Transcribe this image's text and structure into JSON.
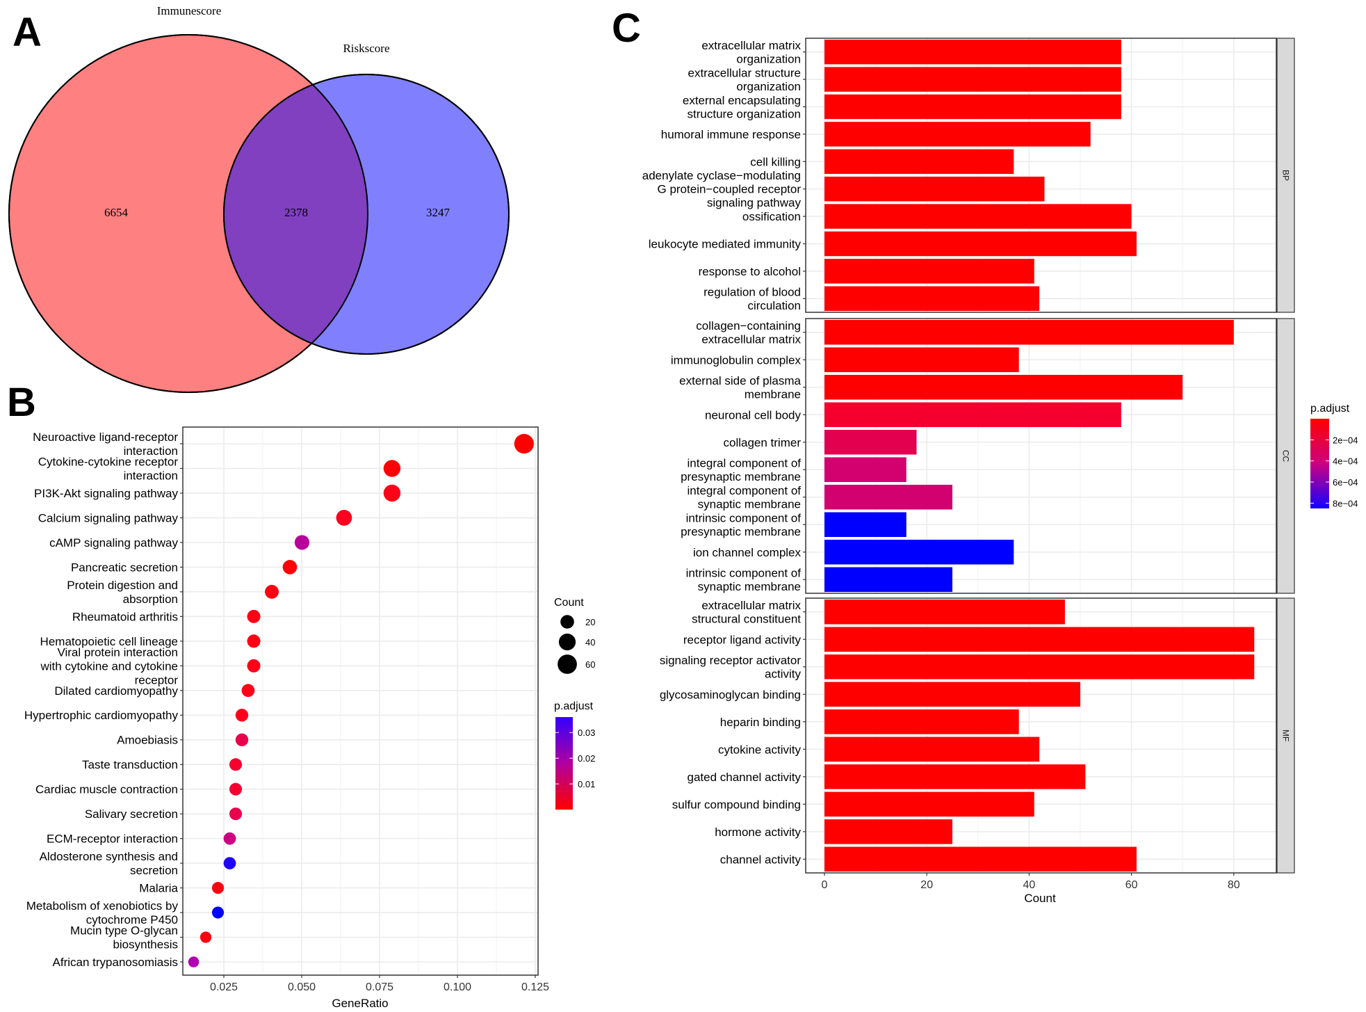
{
  "figure": {
    "panel_labels": [
      "A",
      "B",
      "C"
    ]
  },
  "chart_data": [
    {
      "id": "A",
      "type": "venn",
      "title": "",
      "sets": [
        {
          "name": "Immunescore",
          "only": 6654,
          "color": "#FF8080"
        },
        {
          "name": "Riskscore",
          "only": 3247,
          "color": "#8080FF"
        }
      ],
      "intersection": 2378,
      "intersection_color": "#8040C0"
    },
    {
      "id": "B",
      "type": "scatter",
      "subtype": "dotplot",
      "title": "",
      "xlabel": "GeneRatio",
      "ylabel": "",
      "xlim": [
        0.0125,
        0.1275
      ],
      "xticks": [
        0.025,
        0.05,
        0.075,
        0.1,
        0.125
      ],
      "xtick_labels": [
        "0.025",
        "0.050",
        "0.075",
        "0.100",
        "0.125"
      ],
      "grid": true,
      "legend": {
        "placement": "right",
        "size": {
          "title": "Count",
          "values": [
            20,
            40,
            60
          ],
          "labels": [
            "20",
            "40",
            "60"
          ]
        },
        "color": {
          "title": "p.adjust",
          "range": [
            0.0,
            0.036
          ],
          "ticks": [
            0.01,
            0.02,
            0.03
          ],
          "labels": [
            "0.01",
            "0.02",
            "0.03"
          ],
          "low_color": "#FF0000",
          "high_color": "#0000FF"
        }
      },
      "points": [
        {
          "term": "Neuroactive ligand-receptor interaction",
          "lines": [
            "Neuroactive ligand-receptor",
            "interaction"
          ],
          "gene_ratio": 0.1214,
          "count": 63,
          "p_adjust": 0.0002,
          "color": "#FF0000"
        },
        {
          "term": "Cytokine-cytokine receptor interaction",
          "lines": [
            "Cytokine-cytokine receptor",
            "interaction"
          ],
          "gene_ratio": 0.079,
          "count": 41,
          "p_adjust": 0.001,
          "color": "#FF0008"
        },
        {
          "term": "PI3K-Akt signaling pathway",
          "lines": [
            "PI3K-Akt signaling pathway"
          ],
          "gene_ratio": 0.079,
          "count": 41,
          "p_adjust": 0.002,
          "color": "#FF0018"
        },
        {
          "term": "Calcium signaling pathway",
          "lines": [
            "Calcium signaling pathway"
          ],
          "gene_ratio": 0.0636,
          "count": 33,
          "p_adjust": 0.003,
          "color": "#FC0020"
        },
        {
          "term": "cAMP signaling pathway",
          "lines": [
            "cAMP signaling pathway"
          ],
          "gene_ratio": 0.0501,
          "count": 26,
          "p_adjust": 0.026,
          "color": "#B8009A"
        },
        {
          "term": "Pancreatic secretion",
          "lines": [
            "Pancreatic secretion"
          ],
          "gene_ratio": 0.0462,
          "count": 24,
          "p_adjust": 0.001,
          "color": "#FF0008"
        },
        {
          "term": "Protein digestion and absorption",
          "lines": [
            "Protein digestion and",
            "absorption"
          ],
          "gene_ratio": 0.0404,
          "count": 21,
          "p_adjust": 0.001,
          "color": "#FF0010"
        },
        {
          "term": "Rheumatoid arthritis",
          "lines": [
            "Rheumatoid arthritis"
          ],
          "gene_ratio": 0.0346,
          "count": 18,
          "p_adjust": 0.002,
          "color": "#FF0014"
        },
        {
          "term": "Hematopoietic cell lineage",
          "lines": [
            "Hematopoietic cell lineage"
          ],
          "gene_ratio": 0.0346,
          "count": 18,
          "p_adjust": 0.002,
          "color": "#FF0014"
        },
        {
          "term": "Viral protein interaction with cytokine and cytokine receptor",
          "lines": [
            "Viral protein interaction",
            "with cytokine and cytokine",
            "receptor"
          ],
          "gene_ratio": 0.0346,
          "count": 18,
          "p_adjust": 0.002,
          "color": "#FF0018"
        },
        {
          "term": "Dilated cardiomyopathy",
          "lines": [
            "Dilated cardiomyopathy"
          ],
          "gene_ratio": 0.0328,
          "count": 17,
          "p_adjust": 0.002,
          "color": "#FF0018"
        },
        {
          "term": "Hypertrophic cardiomyopathy",
          "lines": [
            "Hypertrophic cardiomyopathy"
          ],
          "gene_ratio": 0.0308,
          "count": 16,
          "p_adjust": 0.003,
          "color": "#FF001C"
        },
        {
          "term": "Amoebiasis",
          "lines": [
            "Amoebiasis"
          ],
          "gene_ratio": 0.0308,
          "count": 16,
          "p_adjust": 0.008,
          "color": "#E8004C"
        },
        {
          "term": "Taste transduction",
          "lines": [
            "Taste transduction"
          ],
          "gene_ratio": 0.0288,
          "count": 15,
          "p_adjust": 0.004,
          "color": "#F50030"
        },
        {
          "term": "Cardiac muscle contraction",
          "lines": [
            "Cardiac muscle contraction"
          ],
          "gene_ratio": 0.0288,
          "count": 15,
          "p_adjust": 0.004,
          "color": "#F50030"
        },
        {
          "term": "Salivary secretion",
          "lines": [
            "Salivary secretion"
          ],
          "gene_ratio": 0.0288,
          "count": 15,
          "p_adjust": 0.008,
          "color": "#E8004C"
        },
        {
          "term": "ECM-receptor interaction",
          "lines": [
            "ECM-receptor interaction"
          ],
          "gene_ratio": 0.0269,
          "count": 14,
          "p_adjust": 0.016,
          "color": "#CC0080"
        },
        {
          "term": "Aldosterone synthesis and secretion",
          "lines": [
            "Aldosterone synthesis and",
            "secretion"
          ],
          "gene_ratio": 0.0269,
          "count": 14,
          "p_adjust": 0.035,
          "color": "#2000FF"
        },
        {
          "term": "Malaria",
          "lines": [
            "Malaria"
          ],
          "gene_ratio": 0.0231,
          "count": 12,
          "p_adjust": 0.001,
          "color": "#FF0010"
        },
        {
          "term": "Metabolism of xenobiotics by cytochrome P450",
          "lines": [
            "Metabolism of xenobiotics by",
            "cytochrome P450"
          ],
          "gene_ratio": 0.0231,
          "count": 12,
          "p_adjust": 0.036,
          "color": "#0000FF"
        },
        {
          "term": "Mucin type O-glycan biosynthesis",
          "lines": [
            "Mucin type O-glycan",
            "biosynthesis"
          ],
          "gene_ratio": 0.0192,
          "count": 10,
          "p_adjust": 0.001,
          "color": "#FF0010"
        },
        {
          "term": "African trypanosomiasis",
          "lines": [
            "African trypanosomiasis"
          ],
          "gene_ratio": 0.0153,
          "count": 8,
          "p_adjust": 0.022,
          "color": "#B000B0"
        }
      ]
    },
    {
      "id": "C",
      "type": "bar",
      "orientation": "horizontal",
      "title": "",
      "xlabel": "Count",
      "ylabel": "",
      "xlim": [
        0,
        88
      ],
      "xticks": [
        0,
        20,
        40,
        60,
        80
      ],
      "xtick_labels": [
        "0",
        "20",
        "40",
        "60",
        "80"
      ],
      "grid": true,
      "legend": {
        "placement": "right",
        "color": {
          "title": "p.adjust",
          "range": [
            0.0,
            0.00085
          ],
          "ticks": [
            0.0002,
            0.0004,
            0.0006,
            0.0008
          ],
          "labels": [
            "2e−04",
            "4e−04",
            "6e−04",
            "8e−04"
          ],
          "low_color": "#FF0000",
          "high_color": "#0000FF"
        }
      },
      "facets": [
        {
          "name": "BP",
          "bars": [
            {
              "lines": [
                "extracellular matrix",
                "organization"
              ],
              "value": 58,
              "color": "#FF0000"
            },
            {
              "lines": [
                "extracellular structure",
                "organization"
              ],
              "value": 58,
              "color": "#FF0000"
            },
            {
              "lines": [
                "external encapsulating",
                "structure organization"
              ],
              "value": 58,
              "color": "#FF0000"
            },
            {
              "lines": [
                "humoral immune response"
              ],
              "value": 52,
              "color": "#FF0000"
            },
            {
              "lines": [
                "cell killing"
              ],
              "value": 37,
              "color": "#FF0000"
            },
            {
              "lines": [
                "adenylate cyclase−modulating",
                "G protein−coupled receptor",
                "signaling pathway"
              ],
              "value": 43,
              "color": "#FF0000"
            },
            {
              "lines": [
                "ossification"
              ],
              "value": 60,
              "color": "#FF0000"
            },
            {
              "lines": [
                "leukocyte mediated immunity"
              ],
              "value": 61,
              "color": "#FF0000"
            },
            {
              "lines": [
                "response to alcohol"
              ],
              "value": 41,
              "color": "#FF0000"
            },
            {
              "lines": [
                "regulation of blood",
                "circulation"
              ],
              "value": 42,
              "color": "#FF0000"
            }
          ]
        },
        {
          "name": "CC",
          "bars": [
            {
              "lines": [
                "collagen−containing",
                "extracellular matrix"
              ],
              "value": 80,
              "color": "#FF0000"
            },
            {
              "lines": [
                "immunoglobulin complex"
              ],
              "value": 38,
              "color": "#FF0000"
            },
            {
              "lines": [
                "external side of plasma",
                "membrane"
              ],
              "value": 70,
              "color": "#FF0000"
            },
            {
              "lines": [
                "neuronal cell body"
              ],
              "value": 58,
              "color": "#F5002E"
            },
            {
              "lines": [
                "collagen trimer"
              ],
              "value": 18,
              "color": "#E2004F"
            },
            {
              "lines": [
                "integral component of",
                "presynaptic membrane"
              ],
              "value": 16,
              "color": "#D3006F"
            },
            {
              "lines": [
                "integral component of",
                "synaptic membrane"
              ],
              "value": 25,
              "color": "#D3006F"
            },
            {
              "lines": [
                "intrinsic component of",
                "presynaptic membrane"
              ],
              "value": 16,
              "color": "#0000FF"
            },
            {
              "lines": [
                "ion channel complex"
              ],
              "value": 37,
              "color": "#0000FF"
            },
            {
              "lines": [
                "intrinsic component of",
                "synaptic membrane"
              ],
              "value": 25,
              "color": "#0000FF"
            }
          ]
        },
        {
          "name": "MF",
          "bars": [
            {
              "lines": [
                "extracellular matrix",
                "structural constituent"
              ],
              "value": 47,
              "color": "#FF0000"
            },
            {
              "lines": [
                "receptor ligand activity"
              ],
              "value": 84,
              "color": "#FF0000"
            },
            {
              "lines": [
                "signaling receptor activator",
                "activity"
              ],
              "value": 84,
              "color": "#FF0000"
            },
            {
              "lines": [
                "glycosaminoglycan binding"
              ],
              "value": 50,
              "color": "#FF0000"
            },
            {
              "lines": [
                "heparin binding"
              ],
              "value": 38,
              "color": "#FF0000"
            },
            {
              "lines": [
                "cytokine activity"
              ],
              "value": 42,
              "color": "#FF0000"
            },
            {
              "lines": [
                "gated channel activity"
              ],
              "value": 51,
              "color": "#FF0000"
            },
            {
              "lines": [
                "sulfur compound binding"
              ],
              "value": 41,
              "color": "#FF0000"
            },
            {
              "lines": [
                "hormone activity"
              ],
              "value": 25,
              "color": "#FF0000"
            },
            {
              "lines": [
                "channel activity"
              ],
              "value": 61,
              "color": "#FF0000"
            }
          ]
        }
      ]
    }
  ]
}
